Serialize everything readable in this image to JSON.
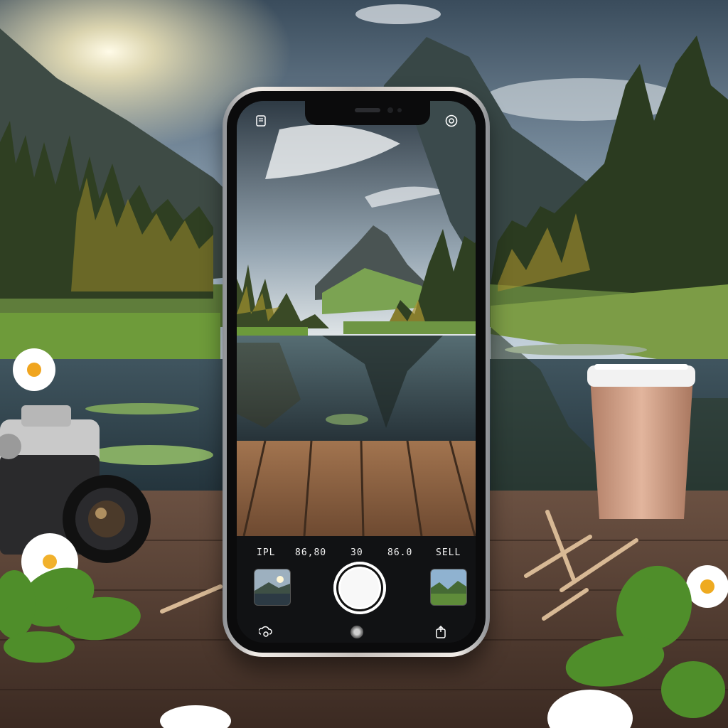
{
  "camera_ui": {
    "modes": [
      "IPL",
      "86,80",
      "30",
      "86.0",
      "SELL"
    ]
  },
  "icons": {
    "top_left": "document-icon",
    "top_right": "settings-ring-icon",
    "bottom_left": "gallery-stack-icon",
    "bottom_right": "share-icon"
  },
  "colors": {
    "phone_frame": "#d9d0ca",
    "screen_bg": "#111214",
    "shutter": "#ffffff"
  }
}
